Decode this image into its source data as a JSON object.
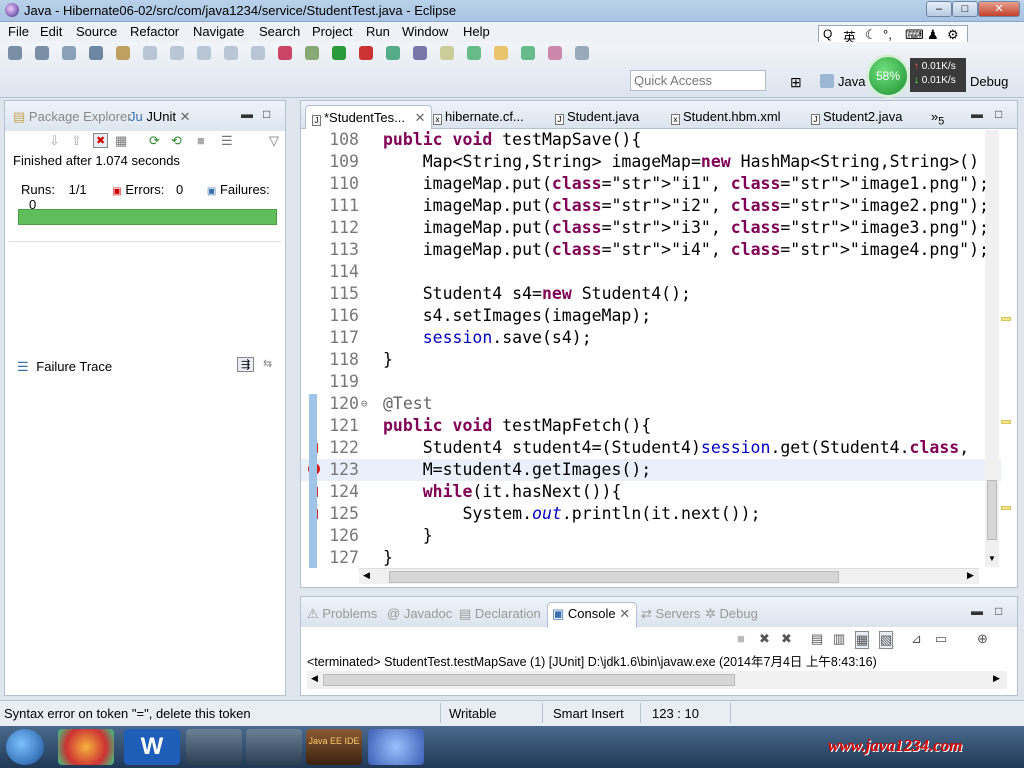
{
  "window": {
    "title": "Java - Hibernate06-02/src/com/java1234/service/StudentTest.java - Eclipse"
  },
  "menu": [
    "File",
    "Edit",
    "Source",
    "Refactor",
    "Navigate",
    "Search",
    "Project",
    "Run",
    "Window",
    "Help"
  ],
  "toolbar": {
    "quick_access_placeholder": "Quick Access",
    "perspectives": [
      "Java",
      "Debug"
    ]
  },
  "ime": {
    "lang": "英"
  },
  "net_monitor": {
    "percent": "58%",
    "up": "0.01K/s",
    "down": "0.01K/s"
  },
  "left_panel": {
    "tabs": [
      "Package Explorer",
      "JUnit"
    ],
    "finished": "Finished after 1.074 seconds",
    "runs_label": "Runs:",
    "runs_value": "1/1",
    "errors_label": "Errors:",
    "errors_value": "0",
    "failures_label": "Failures:",
    "failures_value": "0",
    "failure_trace": "Failure Trace",
    "progress_fraction": 1.0,
    "progress_color": "#5fbd5b"
  },
  "editor": {
    "tabs": [
      "*StudentTes...",
      "hibernate.cf...",
      "Student.java",
      "Student.hbm.xml",
      "Student2.java"
    ],
    "more_tabs": "5",
    "lines": [
      {
        "n": "108",
        "t": "public void testMapSave(){"
      },
      {
        "n": "109",
        "t": "    Map<String,String> imageMap=new HashMap<String,String>()"
      },
      {
        "n": "110",
        "t": "    imageMap.put(\"i1\", \"image1.png\");"
      },
      {
        "n": "111",
        "t": "    imageMap.put(\"i2\", \"image2.png\");"
      },
      {
        "n": "112",
        "t": "    imageMap.put(\"i3\", \"image3.png\");"
      },
      {
        "n": "113",
        "t": "    imageMap.put(\"i4\", \"image4.png\");"
      },
      {
        "n": "114",
        "t": ""
      },
      {
        "n": "115",
        "t": "    Student4 s4=new Student4();"
      },
      {
        "n": "116",
        "t": "    s4.setImages(imageMap);"
      },
      {
        "n": "117",
        "t": "    session.save(s4);"
      },
      {
        "n": "118",
        "t": "}"
      },
      {
        "n": "119",
        "t": ""
      },
      {
        "n": "120",
        "t": "@Test"
      },
      {
        "n": "121",
        "t": "public void testMapFetch(){"
      },
      {
        "n": "122",
        "t": "    Student4 student4=(Student4)session.get(Student4.class,"
      },
      {
        "n": "123",
        "t": "    M=student4.getImages();"
      },
      {
        "n": "124",
        "t": "    while(it.hasNext()){"
      },
      {
        "n": "125",
        "t": "        System.out.println(it.next());"
      },
      {
        "n": "126",
        "t": "    }"
      },
      {
        "n": "127",
        "t": "}"
      }
    ]
  },
  "console": {
    "tabs": [
      "Problems",
      "Javadoc",
      "Declaration",
      "Console",
      "Servers",
      "Debug"
    ],
    "terminated": "<terminated> StudentTest.testMapSave (1) [JUnit] D:\\jdk1.6\\bin\\javaw.exe (2014年7月4日 上午8:43:16)"
  },
  "status": {
    "message": "Syntax error on token \"=\", delete this token",
    "writable": "Writable",
    "insert_mode": "Smart Insert",
    "position": "123 : 10"
  },
  "taskbar": {
    "watermark": "www.java1234.com",
    "app_label": "Java EE IDE"
  },
  "colors": {
    "keyword": "#7f0055",
    "string": "#2a00ff",
    "field": "#0000c0",
    "annotation": "#646464",
    "junit_green": "#5fbd5b",
    "error": "#d21d1d"
  }
}
